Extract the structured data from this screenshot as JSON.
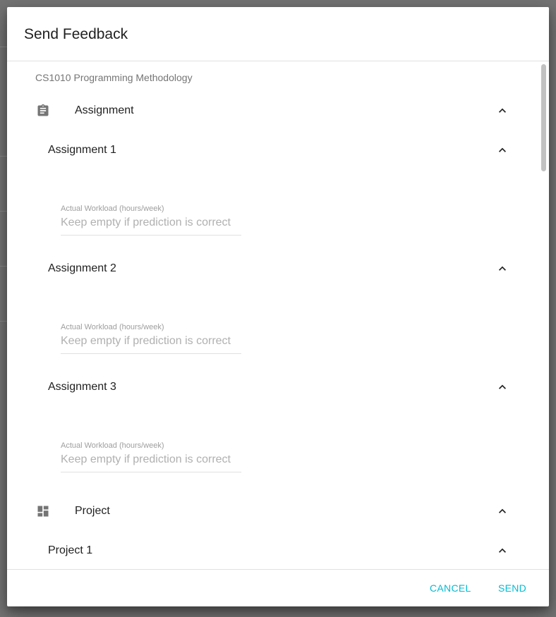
{
  "dialog": {
    "title": "Send Feedback",
    "course": "CS1010 Programming Methodology"
  },
  "sections": [
    {
      "label": "Assignment",
      "icon": "assignment-clipboard-icon",
      "items": [
        {
          "label": "Assignment 1",
          "field_label": "Actual Workload (hours/week)",
          "placeholder": "Keep empty if prediction is correct",
          "value": ""
        },
        {
          "label": "Assignment 2",
          "field_label": "Actual Workload (hours/week)",
          "placeholder": "Keep empty if prediction is correct",
          "value": ""
        },
        {
          "label": "Assignment 3",
          "field_label": "Actual Workload (hours/week)",
          "placeholder": "Keep empty if prediction is correct",
          "value": ""
        }
      ]
    },
    {
      "label": "Project",
      "icon": "project-dashboard-icon",
      "items": [
        {
          "label": "Project 1"
        }
      ]
    }
  ],
  "actions": {
    "cancel_label": "CANCEL",
    "send_label": "SEND"
  },
  "colors": {
    "accent": "#00bcd4",
    "overlay": "#737373",
    "icon": "#757575"
  }
}
